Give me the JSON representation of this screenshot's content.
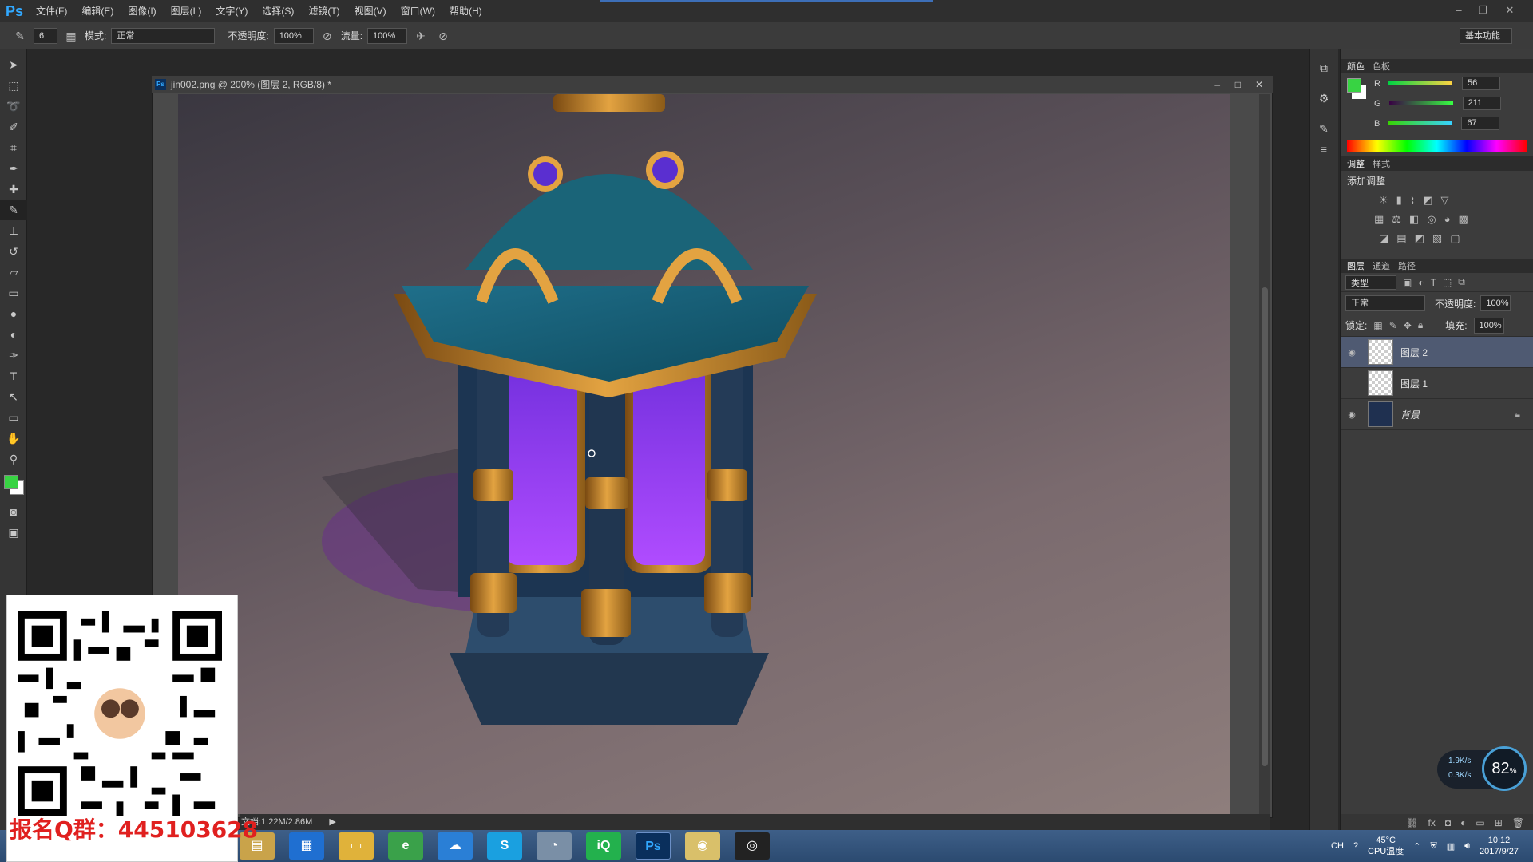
{
  "app": {
    "logo": "Ps"
  },
  "menu": [
    "文件(F)",
    "编辑(E)",
    "图像(I)",
    "图层(L)",
    "文字(Y)",
    "选择(S)",
    "滤镜(T)",
    "视图(V)",
    "窗口(W)",
    "帮助(H)"
  ],
  "options": {
    "brush_size": "6",
    "mode_label": "模式:",
    "mode_value": "正常",
    "opacity_label": "不透明度:",
    "opacity_value": "100%",
    "flow_label": "流量:",
    "flow_value": "100%",
    "workspace": "基本功能"
  },
  "document": {
    "title": "jin002.png @ 200% (图层 2, RGB/8) *",
    "status": "文档:1.22M/2.86M"
  },
  "color_panel": {
    "tabs": [
      "颜色",
      "色板"
    ],
    "fg_color": "#38d343",
    "r": "56",
    "g": "211",
    "b": "67",
    "r_label": "R",
    "g_label": "G",
    "b_label": "B"
  },
  "adjust_panel": {
    "tabs": [
      "调整",
      "样式"
    ],
    "title": "添加调整"
  },
  "layers_panel": {
    "tabs": [
      "图层",
      "通道",
      "路径"
    ],
    "filter": "类型",
    "blend_mode": "正常",
    "opacity_label": "不透明度:",
    "opacity_value": "100%",
    "lock_label": "锁定:",
    "fill_label": "填充:",
    "fill_value": "100%",
    "layers": [
      {
        "name": "图层 2",
        "visible": true,
        "selected": true
      },
      {
        "name": "图层 1",
        "visible": false,
        "selected": false
      },
      {
        "name": "背景",
        "visible": true,
        "selected": false,
        "locked": true
      }
    ]
  },
  "overlay": {
    "qr_caption": "报名Q群：445103628"
  },
  "net_widget": {
    "up": "1.9K/s",
    "down": "0.3K/s",
    "percent": "82"
  },
  "taskbar": {
    "temp": "45°C",
    "temp_label": "CPU温度",
    "time": "10:12",
    "date": "2017/9/27",
    "lang": "CH"
  },
  "colors": {
    "accent": "#31a8ff",
    "selected_layer": "#4f5a72",
    "caption_red": "#e0201f"
  }
}
